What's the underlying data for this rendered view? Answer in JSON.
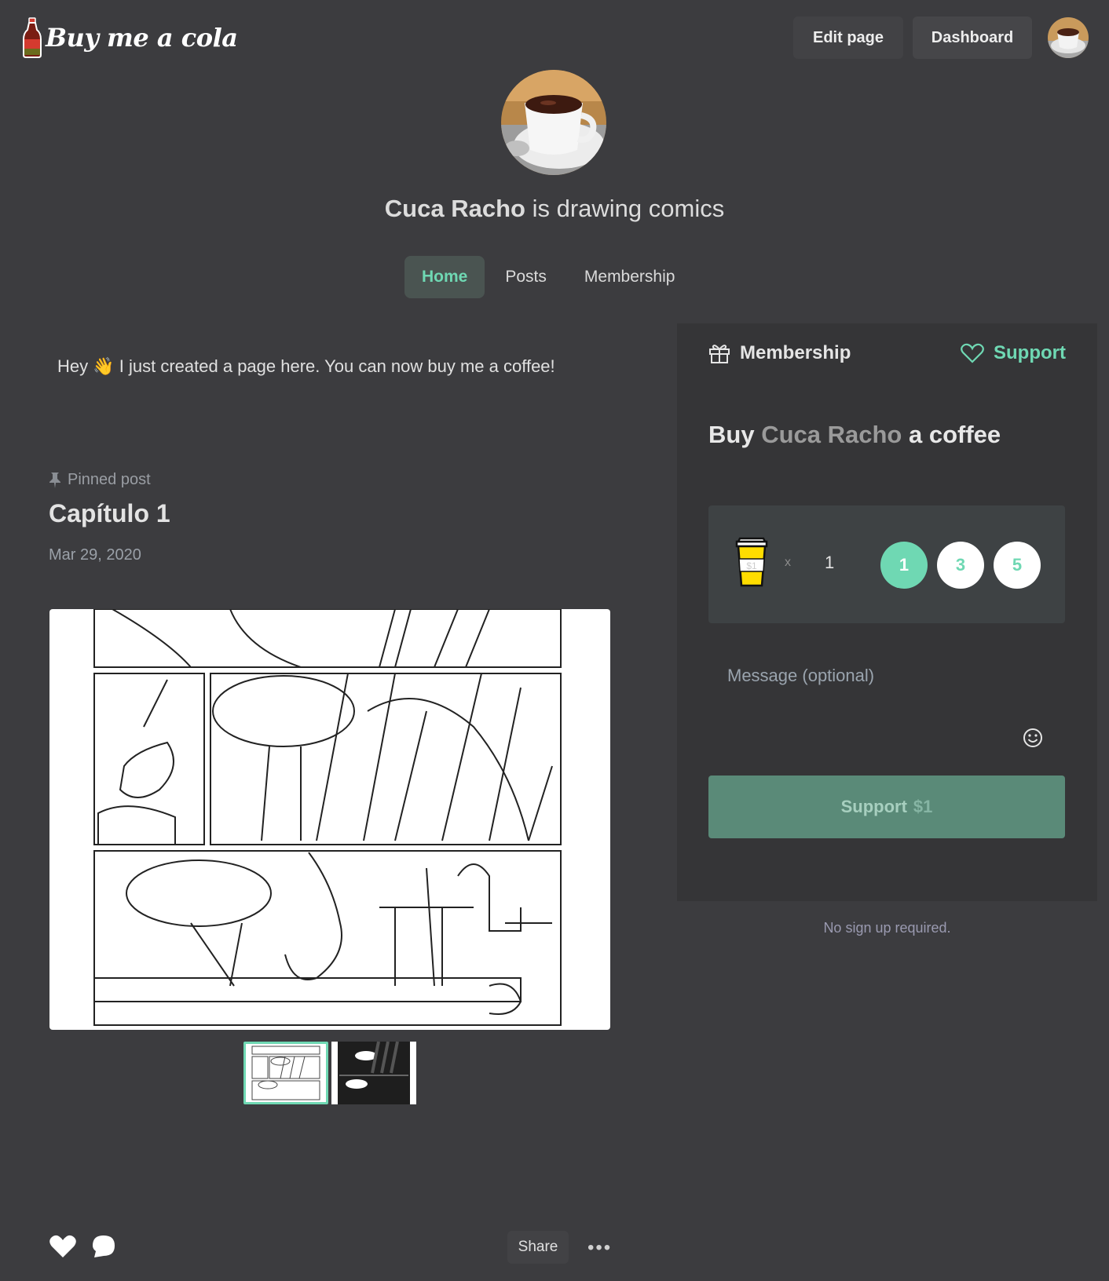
{
  "header": {
    "logo_text": "Buy me a cola",
    "edit_page_label": "Edit page",
    "dashboard_label": "Dashboard"
  },
  "profile": {
    "name": "Cuca Racho",
    "tagline": "is drawing comics"
  },
  "tabs": [
    {
      "label": "Home",
      "active": true
    },
    {
      "label": "Posts",
      "active": false
    },
    {
      "label": "Membership",
      "active": false
    }
  ],
  "intro": {
    "before": "Hey",
    "emoji": "👋",
    "after": "I just created a page here. You can now buy me a coffee!"
  },
  "post": {
    "pinned_label": "Pinned post",
    "title": "Capítulo 1",
    "date": "Mar 29, 2020"
  },
  "card": {
    "membership_label": "Membership",
    "support_label": "Support",
    "buy_prefix": "Buy",
    "buy_name": "Cuca Racho",
    "buy_suffix": "a coffee",
    "cup_price": "$1",
    "times": "x",
    "quantity": "1",
    "quick_options": [
      "1",
      "3",
      "5"
    ],
    "message_placeholder": "Message (optional)",
    "support_button": "Support",
    "support_amount": "$1",
    "no_signup": "No sign up required."
  },
  "footer": {
    "share_label": "Share",
    "more_label": "•••"
  },
  "colors": {
    "accent": "#6fd8b3",
    "background": "#3c3c3f",
    "card": "#353537",
    "support_button": "#5a8a78"
  },
  "icons": {
    "gift": "gift-icon",
    "heart_outline": "heart-outline-icon",
    "pin": "pin-icon",
    "smiley": "smiley-icon",
    "like": "heart-icon",
    "comment": "comment-icon"
  }
}
